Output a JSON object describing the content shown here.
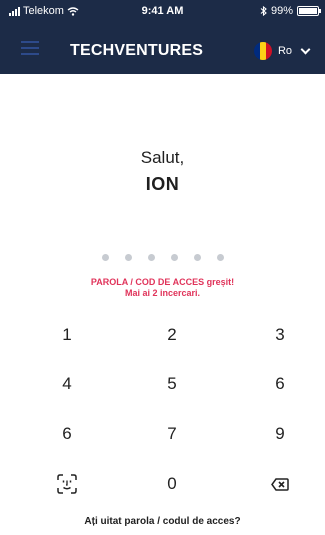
{
  "status_bar": {
    "carrier": "Telekom",
    "time": "9:41 AM",
    "battery_percent": "99%",
    "battery_level": 0.99,
    "icons": [
      "signal-icon",
      "wifi-icon",
      "bluetooth-icon",
      "battery-icon"
    ]
  },
  "header": {
    "brand": "TECHVENTURES",
    "language": "Ro",
    "menu_icon": "hamburger-icon",
    "flag_colors": [
      "#002b7f",
      "#fcd116",
      "#ce1126"
    ],
    "background": "#1c2b47"
  },
  "greeting": {
    "hello": "Salut,",
    "name": "ION"
  },
  "pin": {
    "length": 6,
    "filled": 0
  },
  "error": {
    "line1": "PAROLA / COD DE ACCES greșit!",
    "line2": "Mai ai 2 incercari.",
    "color": "#e0335a"
  },
  "keypad": {
    "k1": "1",
    "k2": "2",
    "k3": "3",
    "k4": "4",
    "k5": "5",
    "k6": "6",
    "k7": "6",
    "k8": "7",
    "k9": "9",
    "k0": "0",
    "face_icon": "face-id-icon",
    "delete_icon": "backspace-icon"
  },
  "forgot_link": "Ați uitat parola / codul de acces?"
}
